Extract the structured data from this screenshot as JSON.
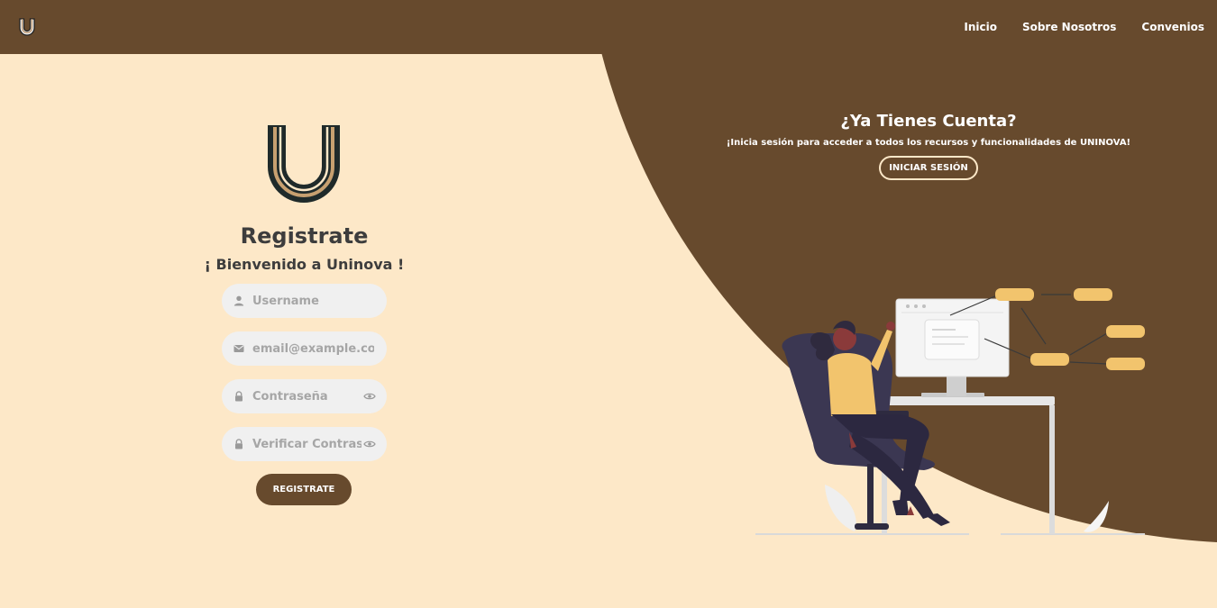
{
  "nav": {
    "links": [
      "Inicio",
      "Sobre Nosotros",
      "Convenios"
    ]
  },
  "colors": {
    "brand_brown": "#674a2d",
    "background_cream": "#fde8c8",
    "accent_gold": "#f2c46d",
    "field_gray": "#f0f0f0"
  },
  "register": {
    "title": "Registrate",
    "subtitle": "¡ Bienvenido a Uninova !",
    "fields": [
      {
        "icon": "user-icon",
        "placeholder": "Username"
      },
      {
        "icon": "mail-icon",
        "placeholder": "email@example.com"
      },
      {
        "icon": "lock-icon",
        "placeholder": "Contraseña"
      },
      {
        "icon": "lock-icon",
        "placeholder": "Verificar Contraseña"
      }
    ],
    "button": "REGISTRATE"
  },
  "login_panel": {
    "title": "¿Ya Tienes Cuenta?",
    "text": "¡Inicia sesión para acceder a todos los recursos y funcionalidades de UNINOVA!",
    "button": "INICIAR SESIÓN"
  }
}
